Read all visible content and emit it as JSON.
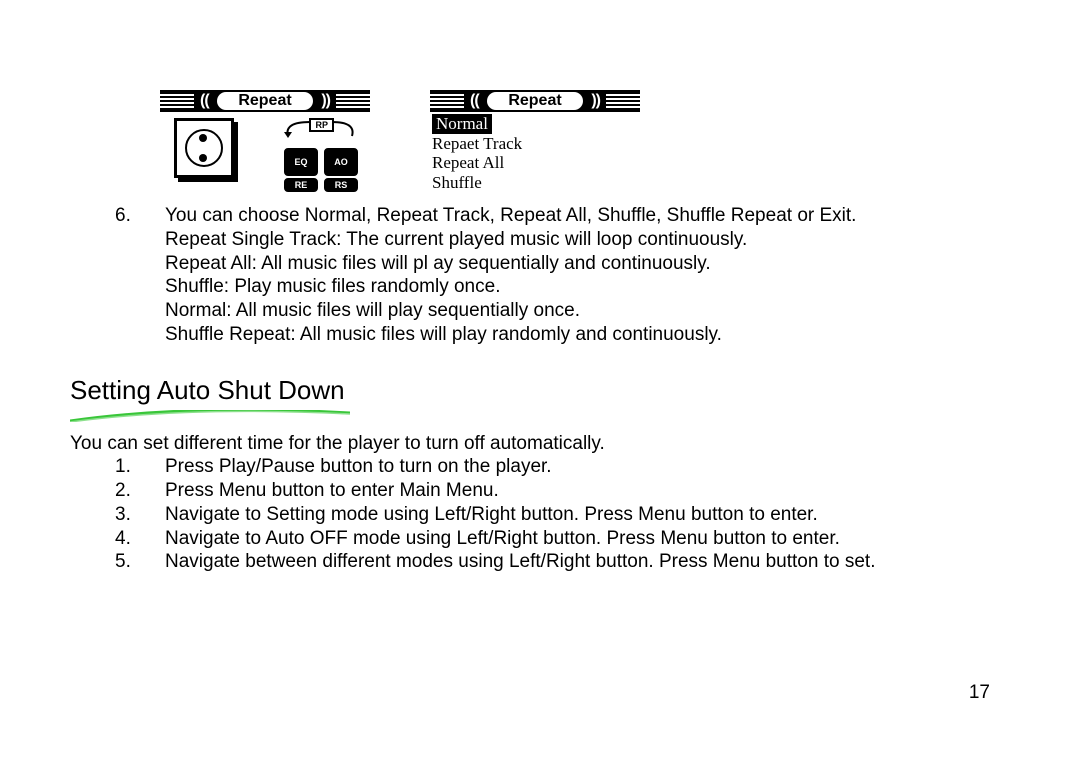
{
  "screens": {
    "left": {
      "header_title": "Repeat",
      "icons": {
        "rp": "RP",
        "eq": "EQ",
        "ao": "AO",
        "re": "RE",
        "rs": "RS"
      }
    },
    "right": {
      "header_title": "Repeat",
      "items": [
        "Normal",
        "Repaet Track",
        "Repeat All",
        "Shuffle"
      ],
      "selected_index": 0
    }
  },
  "repeat_section": {
    "num": "6.",
    "line1": "You can choose Normal, Repeat Track, Repeat All,    Shuffle, Shuffle Repeat or Exit.",
    "lines": [
      "Repeat Single Track: The current played music will loop continuously.",
      "Repeat All: All music files will pl   ay sequentially and continuously.",
      "Shuffle: Play music files randomly once.",
      "Normal: All music files will play sequentially once.",
      "Shuffle Repeat: All music files will play randomly and continuously."
    ]
  },
  "auto_shut_down": {
    "title": "Setting Auto Shut Down",
    "intro": "You can set different time for the    player to turn off automatically.",
    "steps": [
      "Press Play/Pause button to turn on the player.",
      "Press Menu button to enter Main Menu.",
      "Navigate to  Setting  mode using Left/Right   button. Press  Menu button to enter.",
      "Navigate to  Auto OFF mode using Left/Right   button. Press  Menu button to enter.",
      "Navigate between different modes using   Left/Right   button. Press  Menu button to set."
    ]
  },
  "page_number": "17"
}
